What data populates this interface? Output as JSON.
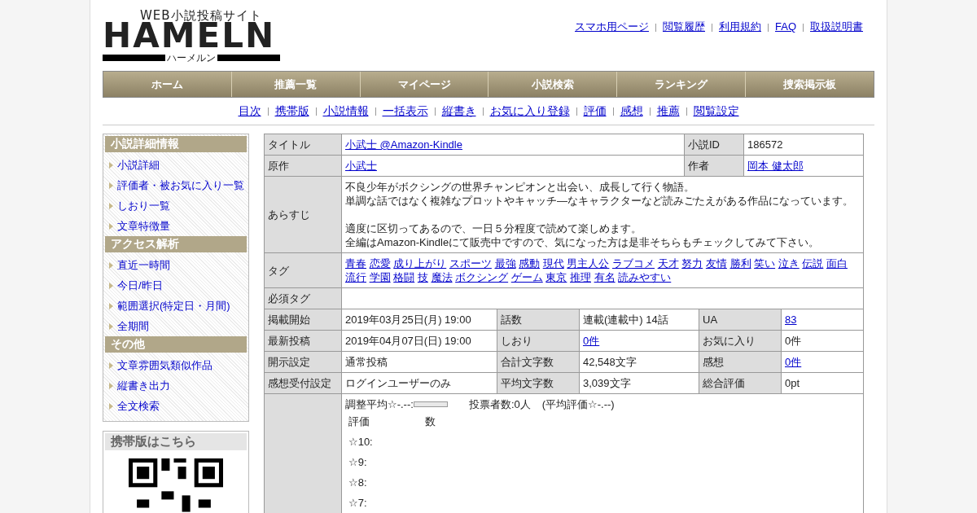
{
  "logo": {
    "tagline": "WEB小説投稿サイト",
    "name": "HAMELN",
    "kana": "ハーメルン"
  },
  "top_links": [
    "スマホ用ページ",
    "閲覧履歴",
    "利用規約",
    "FAQ",
    "取扱説明書"
  ],
  "nav": [
    "ホーム",
    "推薦一覧",
    "マイページ",
    "小説検索",
    "ランキング",
    "捜索掲示板"
  ],
  "sub_nav": [
    "目次",
    "携帯版",
    "小説情報",
    "一括表示",
    "縦書き",
    "お気に入り登録",
    "評価",
    "感想",
    "推薦",
    "閲覧設定"
  ],
  "sidebar": {
    "sections": [
      {
        "title": "小説詳細情報",
        "items": [
          "小説詳細",
          "評価者・被お気に入り一覧",
          "しおり一覧",
          "文章特徴量"
        ]
      },
      {
        "title": "アクセス解析",
        "items": [
          "直近一時間",
          "今日/昨日",
          "範囲選択(特定日・月間)",
          "全期間"
        ]
      },
      {
        "title": "その他",
        "items": [
          "文章雰囲気類似作品",
          "縦書き出力",
          "全文検索"
        ]
      }
    ],
    "mobile": {
      "title": "携帯版はこちら"
    }
  },
  "info": {
    "head_rows": [
      [
        {
          "label": "タイトル",
          "value": "小武士 @Amazon-Kindle",
          "link": true
        },
        {
          "label": "小説ID",
          "value": "186572",
          "link": false
        }
      ],
      [
        {
          "label": "原作",
          "value": "小武士",
          "link": true
        },
        {
          "label": "作者",
          "value": "岡本 健太郎",
          "link": true
        }
      ]
    ],
    "synopsis": {
      "label": "あらすじ",
      "paragraphs": [
        [
          "不良少年がボクシングの世界チャンピオンと出会い、成長して行く物語。",
          "単調な話ではなく複雑なプロットやキャッチ—なキャラクターなど読みごたえがある作品になっています。"
        ],
        [
          "適度に区切ってあるので、一日５分程度で読めて楽しめます。",
          "全編はAmazon-Kindleにて販売中ですので、気になった方は是非そちらもチェックしてみて下さい。"
        ]
      ]
    },
    "tags": {
      "label": "タグ",
      "items": [
        "青春",
        "恋愛",
        "成り上がり",
        "スポーツ",
        "最強",
        "感動",
        "現代",
        "男主人公",
        "ラブコメ",
        "天才",
        "努力",
        "友情",
        "勝利",
        "笑い",
        "泣き",
        "伝説",
        "面白",
        "流行",
        "学園",
        "格闘",
        "技",
        "魔法",
        "ボクシング",
        "ゲーム",
        "東京",
        "推理",
        "有名",
        "読みやすい"
      ]
    },
    "required_tags": {
      "label": "必須タグ"
    },
    "stat_rows": [
      [
        {
          "label": "掲載開始",
          "value": "2019年03月25日(月) 19:00",
          "link": false
        },
        {
          "label": "話数",
          "value": "連載(連載中) 14話",
          "link": false
        },
        {
          "label": "UA",
          "value": "83",
          "link": true
        }
      ],
      [
        {
          "label": "最新投稿",
          "value": "2019年04月07日(日) 19:00",
          "link": false
        },
        {
          "label": "しおり",
          "value": "0件",
          "link": true
        },
        {
          "label": "お気に入り",
          "value": "0件",
          "link": false
        }
      ],
      [
        {
          "label": "開示設定",
          "value": "通常投稿",
          "link": false
        },
        {
          "label": "合計文字数",
          "value": "42,548文字",
          "link": false
        },
        {
          "label": "感想",
          "value": "0件",
          "link": true
        }
      ],
      [
        {
          "label": "感想受付設定",
          "value": "ログインユーザーのみ",
          "link": false
        },
        {
          "label": "平均文字数",
          "value": "3,039文字",
          "link": false
        },
        {
          "label": "総合評価",
          "value": "0pt",
          "link": false
        }
      ]
    ],
    "rating": {
      "adjusted": "調整平均☆-.--:",
      "voters": "投票者数:0人",
      "average": "(平均評価☆-.--)",
      "header": [
        "評価",
        "数"
      ],
      "levels": [
        "☆10:",
        "☆9:",
        "☆8:",
        "☆7:"
      ]
    }
  }
}
